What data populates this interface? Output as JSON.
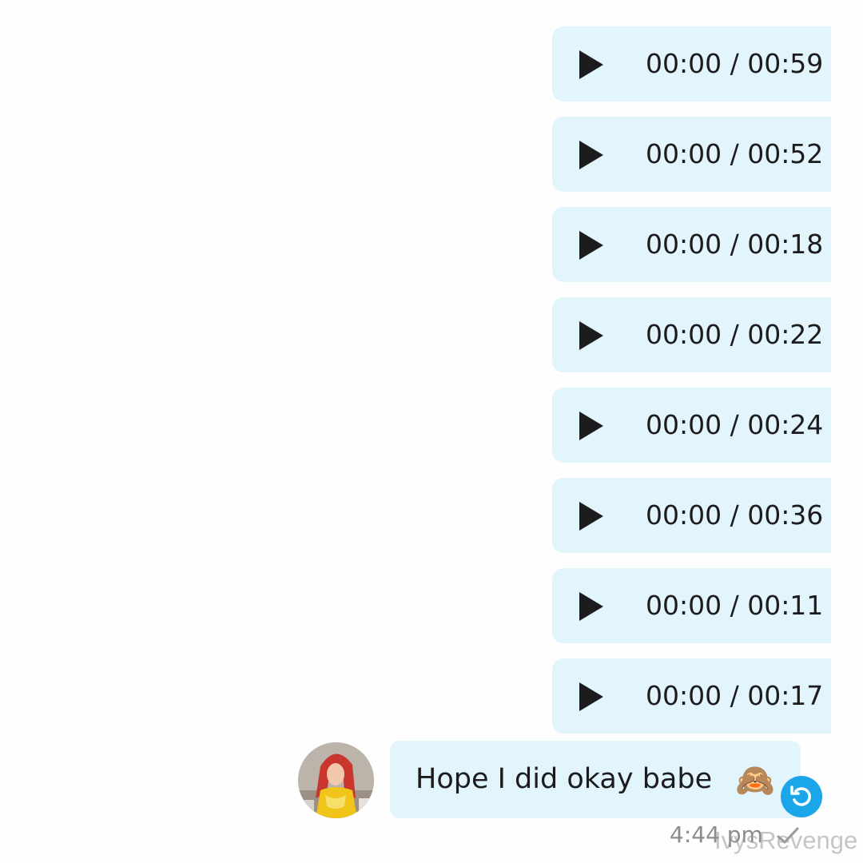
{
  "audio_messages": [
    {
      "elapsed": "00:00",
      "duration": "00:59",
      "time": "00:00 / 00:59"
    },
    {
      "elapsed": "00:00",
      "duration": "00:52",
      "time": "00:00 / 00:52"
    },
    {
      "elapsed": "00:00",
      "duration": "00:18",
      "time": "00:00 / 00:18"
    },
    {
      "elapsed": "00:00",
      "duration": "00:22",
      "time": "00:00 / 00:22"
    },
    {
      "elapsed": "00:00",
      "duration": "00:24",
      "time": "00:00 / 00:24"
    },
    {
      "elapsed": "00:00",
      "duration": "00:36",
      "time": "00:00 / 00:36"
    },
    {
      "elapsed": "00:00",
      "duration": "00:11",
      "time": "00:00 / 00:11"
    },
    {
      "elapsed": "00:00",
      "duration": "00:17",
      "time": "00:00 / 00:17"
    }
  ],
  "text_message": {
    "text": "Hope I did okay babe",
    "emoji": "🙈",
    "timestamp": "4:44 pm",
    "status_icon": "check-icon"
  },
  "watermark": "IvysRevenge",
  "colors": {
    "bubble": "#e2f4fc",
    "accent": "#1aa6e8",
    "text": "#1c1c1e",
    "timestamp": "#8c8c8c"
  }
}
